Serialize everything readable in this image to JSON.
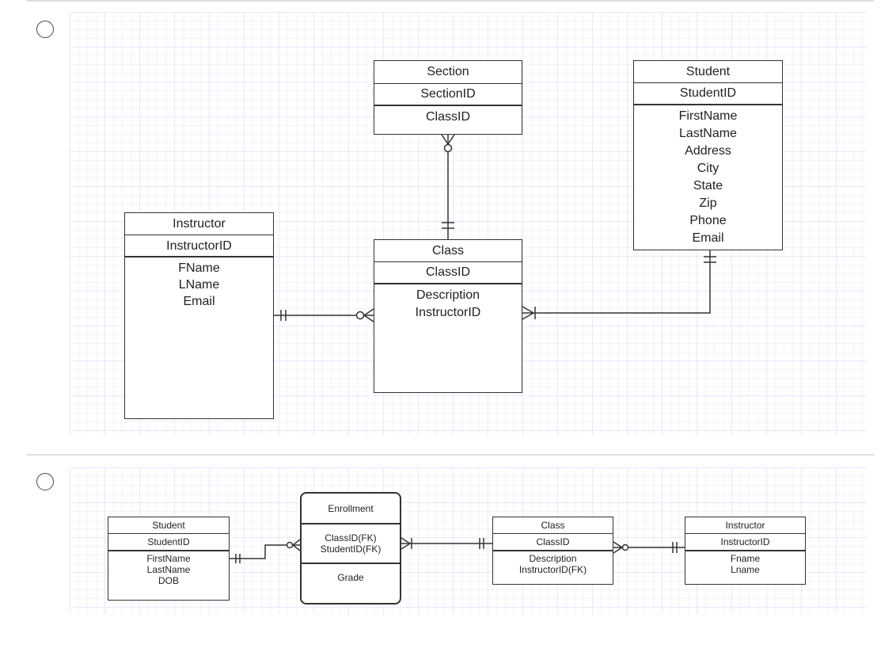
{
  "options": [
    {
      "entities": {
        "section": {
          "name": "Section",
          "key": "SectionID",
          "attrs": [
            "ClassID"
          ]
        },
        "student": {
          "name": "Student",
          "key": "StudentID",
          "attrs": [
            "FirstName",
            "LastName",
            "Address",
            "City",
            "State",
            "Zip",
            "Phone",
            "Email"
          ]
        },
        "instructor": {
          "name": "Instructor",
          "key": "InstructorID",
          "attrs": [
            "FName",
            "LName",
            "Email"
          ]
        },
        "class": {
          "name": "Class",
          "key": "ClassID",
          "attrs": [
            "Description",
            "InstructorID"
          ]
        }
      }
    },
    {
      "entities": {
        "student": {
          "name": "Student",
          "key": "StudentID",
          "attrs": [
            "FirstName",
            "LastName",
            "DOB"
          ]
        },
        "enrollment": {
          "name": "Enrollment",
          "keys": [
            "ClassID(FK)",
            "StudentID(FK)"
          ],
          "attrs": [
            "Grade"
          ]
        },
        "class": {
          "name": "Class",
          "key": "ClassID",
          "attrs": [
            "Description",
            "InstructorID(FK)"
          ]
        },
        "instructor": {
          "name": "Instructor",
          "key": "InstructorID",
          "attrs": [
            "Fname",
            "Lname"
          ]
        }
      }
    }
  ],
  "colors": {
    "line": "#333333",
    "grid": "#e6eafa"
  }
}
